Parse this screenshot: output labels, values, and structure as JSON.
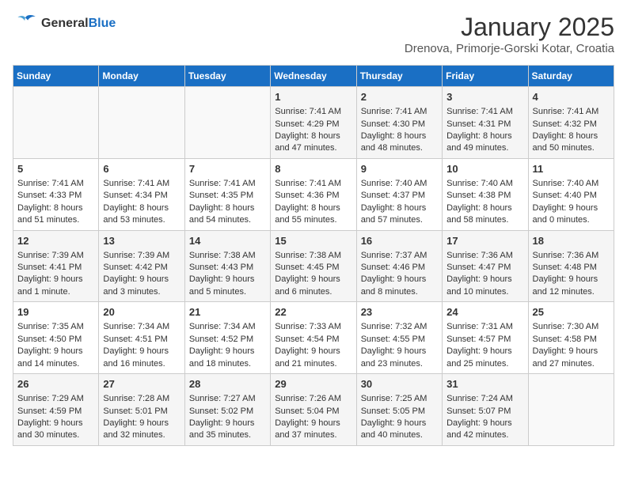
{
  "header": {
    "logo_line1": "General",
    "logo_line2": "Blue",
    "month_title": "January 2025",
    "subtitle": "Drenova, Primorje-Gorski Kotar, Croatia"
  },
  "days_of_week": [
    "Sunday",
    "Monday",
    "Tuesday",
    "Wednesday",
    "Thursday",
    "Friday",
    "Saturday"
  ],
  "weeks": [
    [
      {
        "day": "",
        "content": ""
      },
      {
        "day": "",
        "content": ""
      },
      {
        "day": "",
        "content": ""
      },
      {
        "day": "1",
        "content": "Sunrise: 7:41 AM\nSunset: 4:29 PM\nDaylight: 8 hours and 47 minutes."
      },
      {
        "day": "2",
        "content": "Sunrise: 7:41 AM\nSunset: 4:30 PM\nDaylight: 8 hours and 48 minutes."
      },
      {
        "day": "3",
        "content": "Sunrise: 7:41 AM\nSunset: 4:31 PM\nDaylight: 8 hours and 49 minutes."
      },
      {
        "day": "4",
        "content": "Sunrise: 7:41 AM\nSunset: 4:32 PM\nDaylight: 8 hours and 50 minutes."
      }
    ],
    [
      {
        "day": "5",
        "content": "Sunrise: 7:41 AM\nSunset: 4:33 PM\nDaylight: 8 hours and 51 minutes."
      },
      {
        "day": "6",
        "content": "Sunrise: 7:41 AM\nSunset: 4:34 PM\nDaylight: 8 hours and 53 minutes."
      },
      {
        "day": "7",
        "content": "Sunrise: 7:41 AM\nSunset: 4:35 PM\nDaylight: 8 hours and 54 minutes."
      },
      {
        "day": "8",
        "content": "Sunrise: 7:41 AM\nSunset: 4:36 PM\nDaylight: 8 hours and 55 minutes."
      },
      {
        "day": "9",
        "content": "Sunrise: 7:40 AM\nSunset: 4:37 PM\nDaylight: 8 hours and 57 minutes."
      },
      {
        "day": "10",
        "content": "Sunrise: 7:40 AM\nSunset: 4:38 PM\nDaylight: 8 hours and 58 minutes."
      },
      {
        "day": "11",
        "content": "Sunrise: 7:40 AM\nSunset: 4:40 PM\nDaylight: 9 hours and 0 minutes."
      }
    ],
    [
      {
        "day": "12",
        "content": "Sunrise: 7:39 AM\nSunset: 4:41 PM\nDaylight: 9 hours and 1 minute."
      },
      {
        "day": "13",
        "content": "Sunrise: 7:39 AM\nSunset: 4:42 PM\nDaylight: 9 hours and 3 minutes."
      },
      {
        "day": "14",
        "content": "Sunrise: 7:38 AM\nSunset: 4:43 PM\nDaylight: 9 hours and 5 minutes."
      },
      {
        "day": "15",
        "content": "Sunrise: 7:38 AM\nSunset: 4:45 PM\nDaylight: 9 hours and 6 minutes."
      },
      {
        "day": "16",
        "content": "Sunrise: 7:37 AM\nSunset: 4:46 PM\nDaylight: 9 hours and 8 minutes."
      },
      {
        "day": "17",
        "content": "Sunrise: 7:36 AM\nSunset: 4:47 PM\nDaylight: 9 hours and 10 minutes."
      },
      {
        "day": "18",
        "content": "Sunrise: 7:36 AM\nSunset: 4:48 PM\nDaylight: 9 hours and 12 minutes."
      }
    ],
    [
      {
        "day": "19",
        "content": "Sunrise: 7:35 AM\nSunset: 4:50 PM\nDaylight: 9 hours and 14 minutes."
      },
      {
        "day": "20",
        "content": "Sunrise: 7:34 AM\nSunset: 4:51 PM\nDaylight: 9 hours and 16 minutes."
      },
      {
        "day": "21",
        "content": "Sunrise: 7:34 AM\nSunset: 4:52 PM\nDaylight: 9 hours and 18 minutes."
      },
      {
        "day": "22",
        "content": "Sunrise: 7:33 AM\nSunset: 4:54 PM\nDaylight: 9 hours and 21 minutes."
      },
      {
        "day": "23",
        "content": "Sunrise: 7:32 AM\nSunset: 4:55 PM\nDaylight: 9 hours and 23 minutes."
      },
      {
        "day": "24",
        "content": "Sunrise: 7:31 AM\nSunset: 4:57 PM\nDaylight: 9 hours and 25 minutes."
      },
      {
        "day": "25",
        "content": "Sunrise: 7:30 AM\nSunset: 4:58 PM\nDaylight: 9 hours and 27 minutes."
      }
    ],
    [
      {
        "day": "26",
        "content": "Sunrise: 7:29 AM\nSunset: 4:59 PM\nDaylight: 9 hours and 30 minutes."
      },
      {
        "day": "27",
        "content": "Sunrise: 7:28 AM\nSunset: 5:01 PM\nDaylight: 9 hours and 32 minutes."
      },
      {
        "day": "28",
        "content": "Sunrise: 7:27 AM\nSunset: 5:02 PM\nDaylight: 9 hours and 35 minutes."
      },
      {
        "day": "29",
        "content": "Sunrise: 7:26 AM\nSunset: 5:04 PM\nDaylight: 9 hours and 37 minutes."
      },
      {
        "day": "30",
        "content": "Sunrise: 7:25 AM\nSunset: 5:05 PM\nDaylight: 9 hours and 40 minutes."
      },
      {
        "day": "31",
        "content": "Sunrise: 7:24 AM\nSunset: 5:07 PM\nDaylight: 9 hours and 42 minutes."
      },
      {
        "day": "",
        "content": ""
      }
    ]
  ]
}
